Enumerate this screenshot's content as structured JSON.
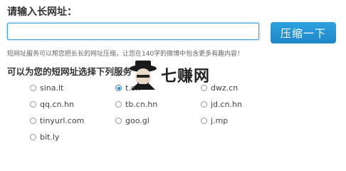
{
  "header": {
    "title": "请输入长网址："
  },
  "url_input": {
    "value": "",
    "placeholder": ""
  },
  "compress_button": {
    "label": "压缩一下"
  },
  "description": "短网址服务可以帮您把长长的网址压缩，让您在140字的微博中包含更多有趣内容！",
  "service_section": {
    "title": "可以为您的短网址选择下列服务",
    "options": [
      {
        "label": "sina.lt",
        "checked": false
      },
      {
        "label": "t.cn",
        "checked": true
      },
      {
        "label": "dwz.cn",
        "checked": false
      },
      {
        "label": "qq.cn.hn",
        "checked": false
      },
      {
        "label": "tb.cn.hn",
        "checked": false
      },
      {
        "label": "jd.cn.hn",
        "checked": false
      },
      {
        "label": "tinyurl.com",
        "checked": false
      },
      {
        "label": "goo.gl",
        "checked": false
      },
      {
        "label": "j.mp",
        "checked": false
      },
      {
        "label": "bit.ly",
        "checked": false
      }
    ]
  },
  "watermark": {
    "text": "七赚网"
  },
  "colors": {
    "accent": "#1f8fd6",
    "input_border": "#4aa3d8"
  }
}
